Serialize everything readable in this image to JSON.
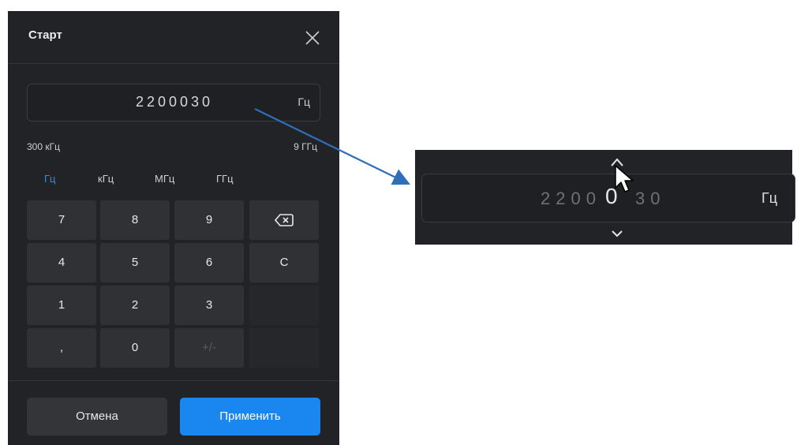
{
  "dialog": {
    "title": "Старт",
    "close_icon": "close-icon",
    "value": "2200030",
    "unit": "Гц",
    "range_min": "300 кГц",
    "range_max": "9 ГГц",
    "unit_tabs": [
      {
        "label": "Гц",
        "active": true
      },
      {
        "label": "кГц",
        "active": false
      },
      {
        "label": "МГц",
        "active": false
      },
      {
        "label": "ГГц",
        "active": false
      }
    ],
    "keys": [
      "7",
      "8",
      "9",
      "4",
      "5",
      "6",
      "C",
      "1",
      "2",
      "3",
      ",",
      "0",
      "+/-"
    ],
    "backspace_icon": "backspace-icon",
    "cancel_label": "Отмена",
    "apply_label": "Применить"
  },
  "zoom": {
    "digits_before": "2200",
    "digit_active": "0",
    "digits_after": "30",
    "unit": "Гц",
    "up_icon": "chevron-up-icon",
    "down_icon": "chevron-down-icon"
  },
  "colors": {
    "dialog_bg": "#222326",
    "key_bg": "#303135",
    "accent": "#1a86f0",
    "active_tab": "#2f8ff0",
    "arrow": "#2e6fb8"
  }
}
